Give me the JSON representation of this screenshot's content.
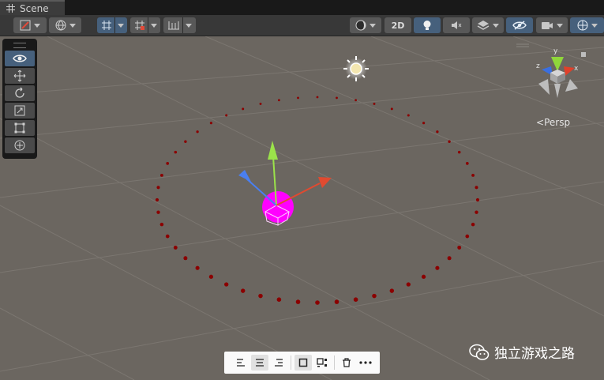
{
  "tab": {
    "title": "Scene",
    "icon": "grid-icon"
  },
  "toolbar": {
    "buttons": [
      {
        "name": "draw-mode-button",
        "icon": "shading-brush-icon",
        "has_dropdown": true
      },
      {
        "name": "global-local-button",
        "icon": "globe-icon",
        "has_dropdown": true
      },
      {
        "name": "grid-snap-button",
        "icon": "grid-snap-icon",
        "has_dropdown": true,
        "active": true
      },
      {
        "name": "increment-snap-button",
        "icon": "snap-increment-icon",
        "has_dropdown": true
      },
      {
        "name": "grid-visibility-button",
        "icon": "grid-ruler-icon",
        "has_dropdown": true
      },
      {
        "name": "render-mode-button",
        "icon": "shading-sphere-icon",
        "has_dropdown": true
      },
      {
        "name": "2d-toggle-button",
        "label": "2D"
      },
      {
        "name": "lighting-toggle-button",
        "icon": "lightbulb-icon",
        "active": true
      },
      {
        "name": "audio-toggle-button",
        "icon": "speaker-icon"
      },
      {
        "name": "effects-button",
        "icon": "layers-icon",
        "has_dropdown": true
      },
      {
        "name": "hidden-objects-button",
        "icon": "eye-slash-icon",
        "active": true
      },
      {
        "name": "camera-button",
        "icon": "camera-icon",
        "has_dropdown": true
      },
      {
        "name": "gizmos-button",
        "icon": "gizmo-globe-icon",
        "has_dropdown": true,
        "active": true
      }
    ]
  },
  "tools": [
    {
      "name": "view-tool",
      "icon": "eye-icon",
      "active": true
    },
    {
      "name": "move-tool",
      "icon": "move-arrows-icon"
    },
    {
      "name": "rotate-tool",
      "icon": "rotate-icon"
    },
    {
      "name": "scale-tool",
      "icon": "scale-icon"
    },
    {
      "name": "rect-tool",
      "icon": "rect-icon"
    },
    {
      "name": "transform-tool",
      "icon": "transform-icon"
    }
  ],
  "gizmo": {
    "axes": [
      "y",
      "z",
      "x"
    ],
    "projection_label": "Persp"
  },
  "overlay_toolbar": {
    "items": [
      "align-left-icon",
      "align-center-icon",
      "align-right-icon",
      "single-square-icon",
      "grid-square-icon",
      "trash-icon",
      "more-icon"
    ],
    "selected": [
      1,
      3
    ]
  },
  "watermark": {
    "text": "独立游戏之路"
  },
  "colors": {
    "viewport": "#6b6660",
    "toolbar": "#383838",
    "active_button": "#46607c",
    "selected_object": "#ff00ff",
    "x_axis": "#e0402a",
    "y_axis": "#8fd63a",
    "z_axis": "#3a6fe0",
    "dots": "#8b0000"
  }
}
